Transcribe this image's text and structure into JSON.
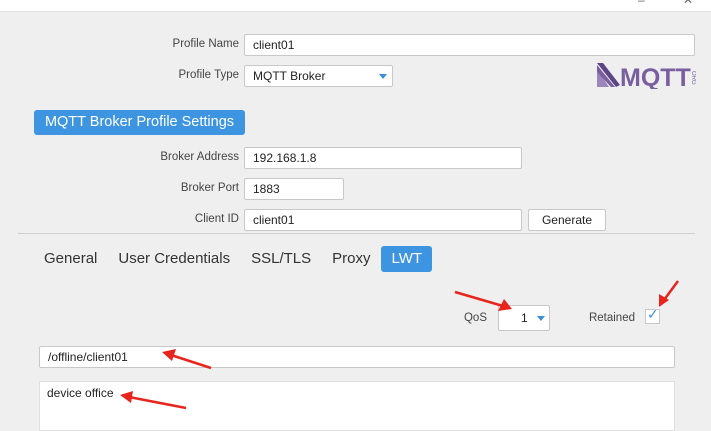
{
  "window": {
    "minimize_glyph": "–",
    "close_glyph": "✕"
  },
  "profile": {
    "name_label": "Profile Name",
    "name_value": "client01",
    "type_label": "Profile Type",
    "type_value": "MQTT Broker",
    "logo_text": "MQTT",
    "logo_subtext": "ORG"
  },
  "broker": {
    "section_title": "MQTT Broker Profile Settings",
    "address_label": "Broker Address",
    "address_value": "192.168.1.8",
    "port_label": "Broker Port",
    "port_value": "1883",
    "client_id_label": "Client ID",
    "client_id_value": "client01",
    "generate_label": "Generate"
  },
  "tabs": [
    {
      "label": "General",
      "active": false
    },
    {
      "label": "User Credentials",
      "active": false
    },
    {
      "label": "SSL/TLS",
      "active": false
    },
    {
      "label": "Proxy",
      "active": false
    },
    {
      "label": "LWT",
      "active": true
    }
  ],
  "lwt": {
    "qos_label": "QoS",
    "qos_value": "1",
    "retained_label": "Retained",
    "retained_checked": true,
    "check_glyph": "✓",
    "topic_value": "/offline/client01",
    "message_value": "device office"
  },
  "colors": {
    "accent": "#3d95e2",
    "annotation_arrow": "#e8251c",
    "logo_purple": "#7a5fa0"
  },
  "icons": {
    "caret": "chevron-down-icon",
    "check": "check-icon",
    "arrow": "arrow-annotation-icon"
  }
}
